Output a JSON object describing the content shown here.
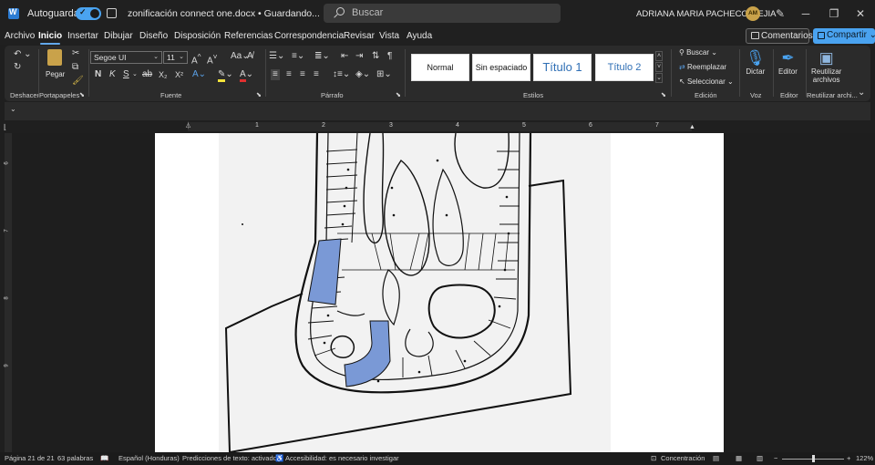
{
  "titlebar": {
    "autosave_label": "Autoguardado",
    "filename": "zonificación connect one.docx • Guardando... ⌄",
    "search_placeholder": "Buscar",
    "user_name": "ADRIANA MARIA PACHECO MEJIA",
    "user_initials": "AM",
    "minimize": "─",
    "maximize": "❐",
    "close": "✕"
  },
  "menu": {
    "tabs": [
      "Archivo",
      "Inicio",
      "Insertar",
      "Dibujar",
      "Diseño",
      "Disposición",
      "Referencias",
      "Correspondencia",
      "Revisar",
      "Vista",
      "Ayuda"
    ],
    "active": "Inicio",
    "comments_label": "Comentarios",
    "share_label": "Compartir ⌄"
  },
  "ribbon": {
    "groups": {
      "undo": "Deshacer",
      "clipboard": "Portapapeles",
      "font": "Fuente",
      "paragraph": "Párrafo",
      "styles": "Estilos",
      "editing": "Edición",
      "voice": "Voz",
      "editor": "Editor",
      "reuse": "Reutilizar archi..."
    },
    "paste_label": "Pegar",
    "font_name": "Segoe UI",
    "font_size": "11",
    "styles": [
      "Normal",
      "Sin espaciado",
      "Título 1",
      "Título 2"
    ],
    "editing": {
      "find": "Buscar",
      "replace": "Reemplazar",
      "select": "Seleccionar"
    },
    "dictate": "Dictar",
    "editor_btn": "Editor",
    "reuse_line1": "Reutilizar",
    "reuse_line2": "archivos",
    "font_buttons": {
      "bold": "N",
      "italic": "K",
      "underline": "S",
      "strike": "ab",
      "subscript": "X₂",
      "superscript": "X²"
    }
  },
  "ruler": {
    "numbers": [
      "1",
      "1",
      "2",
      "3",
      "4",
      "5",
      "6",
      "7"
    ],
    "vertical_numbers": [
      "6",
      "7",
      "8",
      "9"
    ]
  },
  "statusbar": {
    "page": "Página 21 de 21",
    "words": "63 palabras",
    "language": "Español (Honduras)",
    "predictions": "Predicciones de texto: activado",
    "accessibility": "Accesibilidad: es necesario investigar",
    "focus": "Concentración",
    "zoom": "122%"
  },
  "colors": {
    "accent": "#4aa3f0",
    "highlight_zone": "#7a99d6"
  }
}
